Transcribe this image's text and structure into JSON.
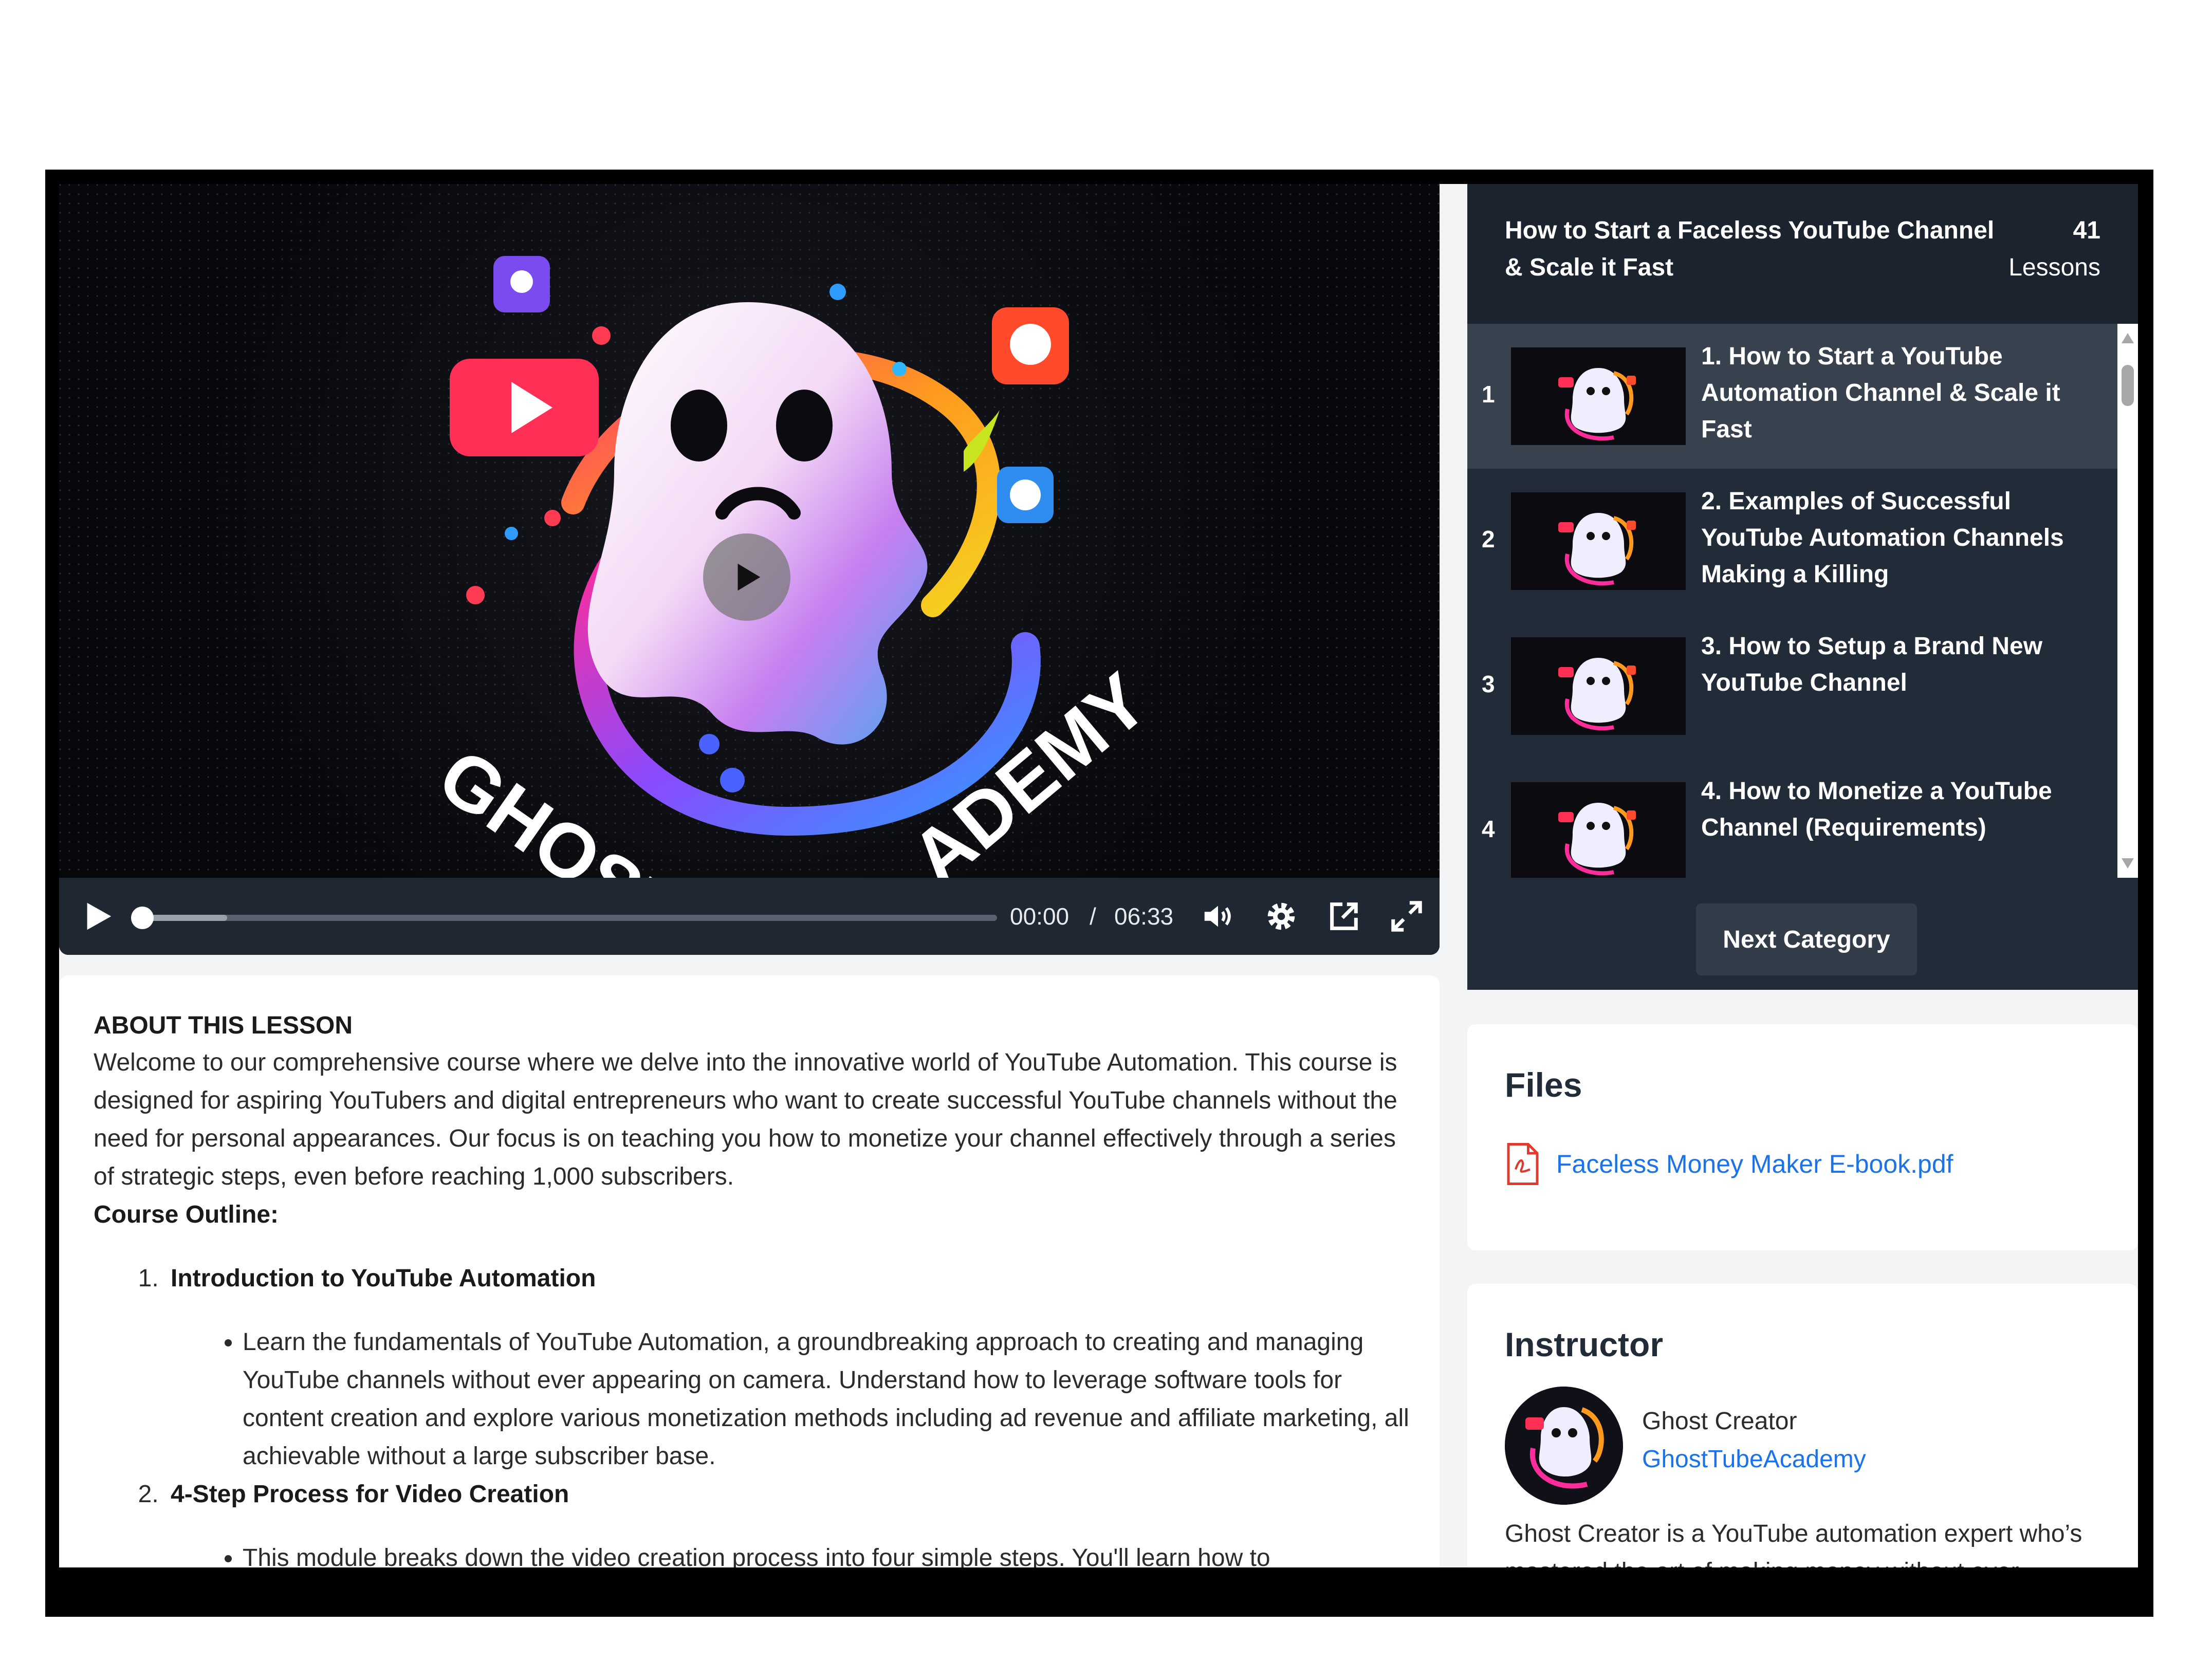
{
  "video": {
    "current_time": "00:00",
    "separator": "/",
    "duration": "06:33",
    "progress_fraction": 0.0,
    "buffered_fraction": 0.07,
    "artwork_text": "GHOSTTUBEACADEMY"
  },
  "lesson": {
    "about_title": "ABOUT THIS LESSON",
    "intro": "Welcome to our comprehensive course where we delve into the innovative world of YouTube Automation. This course is designed for aspiring YouTubers and digital entrepreneurs who want to create successful YouTube channels without the need for personal appearances. Our focus is on teaching you how to monetize your channel effectively through a series of strategic steps, even before reaching 1,000 subscribers.",
    "outline_title": "Course Outline:",
    "outline": [
      {
        "title": "Introduction to YouTube Automation",
        "bullet": "Learn the fundamentals of YouTube Automation, a groundbreaking approach to creating and managing YouTube channels without ever appearing on camera. Understand how to leverage software tools for content creation and explore various monetization methods including ad revenue and affiliate marketing, all achievable without a large subscriber base."
      },
      {
        "title": "4-Step Process for Video Creation",
        "bullet": "This module breaks down the video creation process into four simple steps. You'll learn how to"
      }
    ]
  },
  "playlist": {
    "course_title": "How to Start a Faceless YouTube Channel & Scale it Fast",
    "lesson_count": "41",
    "lesson_count_label": "Lessons",
    "items": [
      {
        "num": "1",
        "title": "1. How to Start a YouTube Automation Channel & Scale it Fast"
      },
      {
        "num": "2",
        "title": "2. Examples of Successful YouTube Automation Channels Making a Killing"
      },
      {
        "num": "3",
        "title": "3. How to Setup a Brand New YouTube Channel"
      },
      {
        "num": "4",
        "title": "4. How to Monetize a YouTube Channel (Requirements)"
      }
    ],
    "next_label": "Next Category"
  },
  "files": {
    "title": "Files",
    "items": [
      {
        "name": "Faceless Money Maker E-book.pdf"
      }
    ]
  },
  "instructor": {
    "title": "Instructor",
    "name": "Ghost Creator",
    "handle": "GhostTubeAcademy",
    "bio": "Ghost Creator is a YouTube automation expert who’s mastered the art of making money without ever"
  },
  "colors": {
    "sidebar_bg": "#222b38",
    "active_item_bg": "#38414e",
    "link_blue": "#1a73e8",
    "control_bar": "#1f2733"
  },
  "icons": [
    "play-icon",
    "volume-icon",
    "gear-icon",
    "popout-icon",
    "fullscreen-icon",
    "pdf-icon"
  ]
}
